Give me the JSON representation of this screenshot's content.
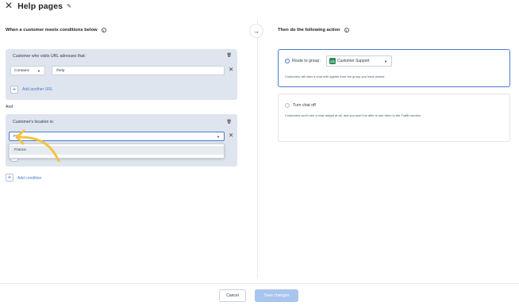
{
  "header": {
    "title": "Help pages"
  },
  "left": {
    "heading": "When a customer meets conditions below",
    "condition1": {
      "title": "Customer who visits URL adresses that:",
      "operator": "Contains",
      "url_value": "/help",
      "add_url_label": "Add another URL"
    },
    "and_label": "And",
    "condition2": {
      "title": "Customer's location is:",
      "input_value": "Fra",
      "option": "France"
    },
    "add_condition_label": "Add condition"
  },
  "right": {
    "heading": "Then do the following action",
    "option1": {
      "label": "Route to group:",
      "group_badge": "CS",
      "group_name": "Customer Support",
      "description": "Customers will start a chat with agents from the group you have picked"
    },
    "option2": {
      "label": "Turn chat off",
      "description": "Customers won't see a chat widget at all, and you won't be able to see them in the Traffic section."
    }
  },
  "footer": {
    "cancel_label": "Cancel",
    "save_label": "Save changes"
  },
  "colors": {
    "accent": "#4a7bd1",
    "condition_bg": "#dfe5ee",
    "save_disabled": "#a9c4ee",
    "badge_green": "#2e8b57",
    "arrow_yellow": "#f5c242"
  },
  "icons": [
    "close-icon",
    "pencil-icon",
    "info-icon",
    "arrow-right-icon",
    "trash-icon",
    "chevron-down-icon",
    "plus-icon"
  ]
}
